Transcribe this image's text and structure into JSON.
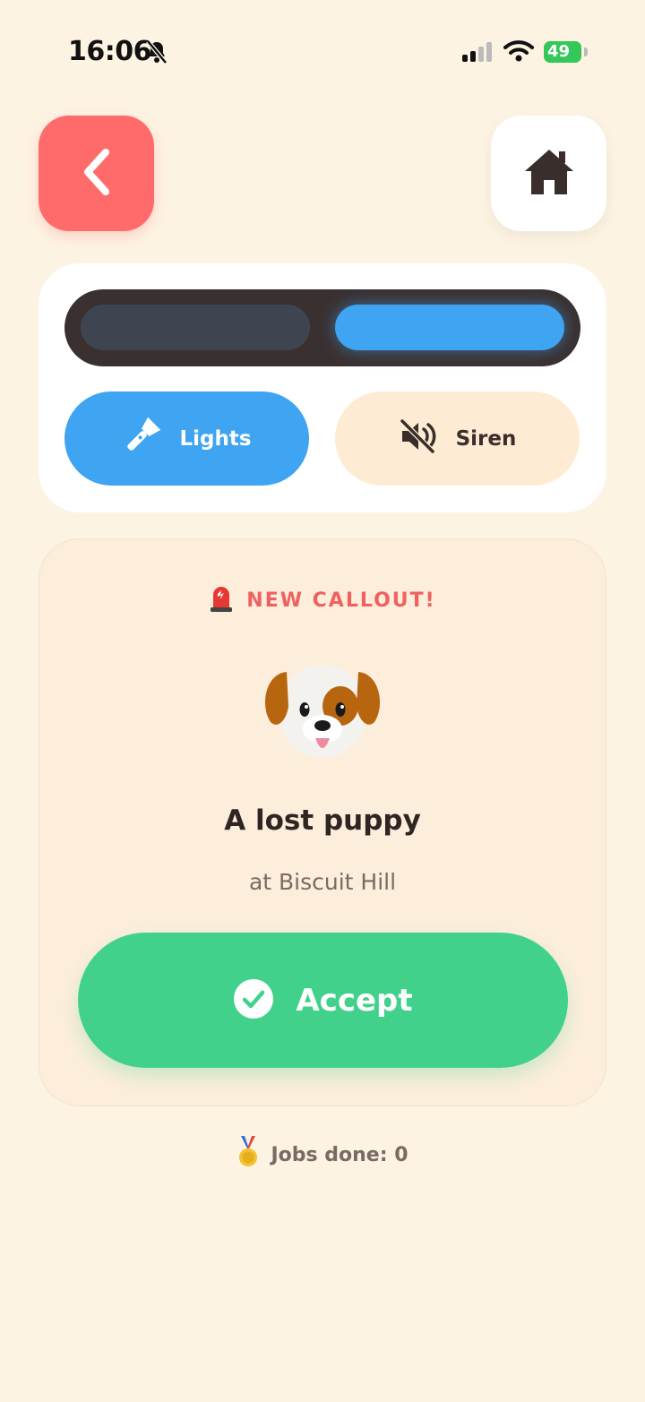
{
  "status_bar": {
    "time": "16:06",
    "battery": "49"
  },
  "nav": {
    "back_icon": "chevron-left-icon",
    "home_icon": "home-icon"
  },
  "controls": {
    "lights_label": "Lights",
    "siren_label": "Siren",
    "lights_icon": "flashlight-icon",
    "siren_icon": "speaker-muted-icon"
  },
  "callout": {
    "badge_icon": "siren-light-icon",
    "badge_label": "NEW CALLOUT!",
    "animal_icon": "puppy-face-icon",
    "title": "A lost puppy",
    "location": "at Biscuit Hill",
    "accept_label": "Accept"
  },
  "footer": {
    "medal_icon": "medal-icon",
    "jobs_done": "Jobs done: 0"
  },
  "colors": {
    "background": "#FDF3E3",
    "back_button": "#FF6B6B",
    "active_blue": "#3FA4F2",
    "accept_green": "#42D18A",
    "callout_red": "#F06060"
  }
}
